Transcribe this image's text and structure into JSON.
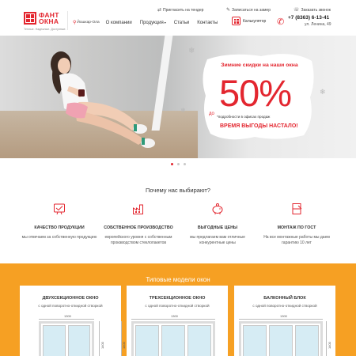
{
  "brand": {
    "name_line1": "ФАНТ",
    "name_line2": "ОКНА",
    "slogan": "Теплые. Надежные. Доступные.",
    "color": "#e3262f"
  },
  "topmenu": {
    "tender_icon": "handshake-icon",
    "tender": "Пригласить на тендер",
    "measure_icon": "pencil-icon",
    "measure": "Записаться на замер",
    "callback_icon": "phone-icon",
    "callback": "Заказать звонок"
  },
  "nav": {
    "city": "Йошкар-Ола",
    "items": [
      "О компании",
      "Продукция",
      "Статьи",
      "Контакты"
    ]
  },
  "calculator": {
    "label": "Калькулятор",
    "icon": "calculator-icon"
  },
  "contacts": {
    "phone": "+7 (8363) 6-13-41",
    "address": "ул. Ленина, 49"
  },
  "hero": {
    "title": "Зимние скидки на наши окна",
    "prefix": "до",
    "discount": "50%",
    "note": "*подробности в офисах продаж",
    "cta": "ВРЕМЯ ВЫГОДЫ НАСТАЛО!",
    "slides": 3,
    "active_slide": 1
  },
  "why": {
    "title": "Почему нас выбирают?",
    "features": [
      {
        "icon": "quality-icon",
        "title": "КАЧЕСТВО ПРОДУКЦИИ",
        "text": "мы отвечаем за собственную продукцию"
      },
      {
        "icon": "factory-icon",
        "title": "СОБСТВЕННОЕ ПРОИЗВОДСТВО",
        "text": "европейского уровня с собственным производством стеклопакетов"
      },
      {
        "icon": "piggy-bank-icon",
        "title": "ВЫГОДНЫЕ ЦЕНЫ",
        "text": "мы предлагаем вам отличные конкурентные цены"
      },
      {
        "icon": "mounting-icon",
        "title": "МОНТАЖ ПО ГОСТ",
        "text": "На все монтажные работы мы даем гарантию 10 лет"
      }
    ]
  },
  "models": {
    "title": "Типовые модели окон",
    "background": "#f6a023",
    "cards": [
      {
        "title": "ДВУХСЕКЦИОННОЕ ОКНО",
        "subtitle": "с одной поворотно-откидной створкой",
        "width": "1300",
        "height": "1400"
      },
      {
        "title": "ТРЕХСЕКЦИОННОЕ ОКНО",
        "subtitle": "с одной поворотно-откидной створкой",
        "width": "1300",
        "height": "1400"
      },
      {
        "title": "БАЛКОННЫЙ БЛОК",
        "subtitle": "с одной поворотно-откидной створкой",
        "width": "1300",
        "height": "1400"
      }
    ]
  }
}
